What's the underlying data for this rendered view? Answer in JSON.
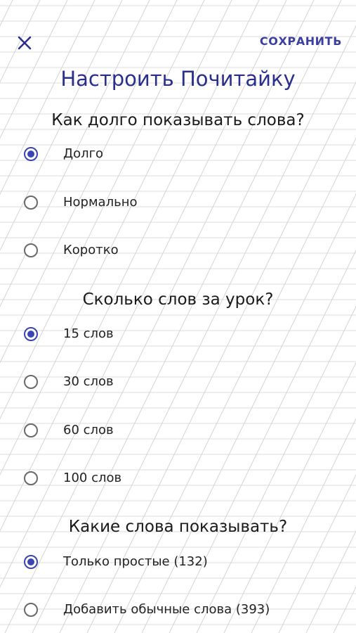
{
  "header": {
    "close_icon": "close-icon",
    "save_label": "СОХРАНИТЬ",
    "title": "Настроить Почитайку"
  },
  "colors": {
    "accent": "#3a46b0",
    "title": "#2b2f8c",
    "grid": "#d8d8d8"
  },
  "sections": [
    {
      "title": "Как долго показывать слова?",
      "options": [
        {
          "label": "Долго",
          "selected": true
        },
        {
          "label": "Нормально",
          "selected": false
        },
        {
          "label": "Коротко",
          "selected": false
        }
      ]
    },
    {
      "title": "Сколько слов за урок?",
      "options": [
        {
          "label": "15 слов",
          "selected": true
        },
        {
          "label": "30 слов",
          "selected": false
        },
        {
          "label": "60 слов",
          "selected": false
        },
        {
          "label": "100 слов",
          "selected": false
        }
      ]
    },
    {
      "title": "Какие слова показывать?",
      "options": [
        {
          "label": "Только простые (132)",
          "selected": true
        },
        {
          "label": "Добавить обычные слова (393)",
          "selected": false
        }
      ]
    }
  ]
}
